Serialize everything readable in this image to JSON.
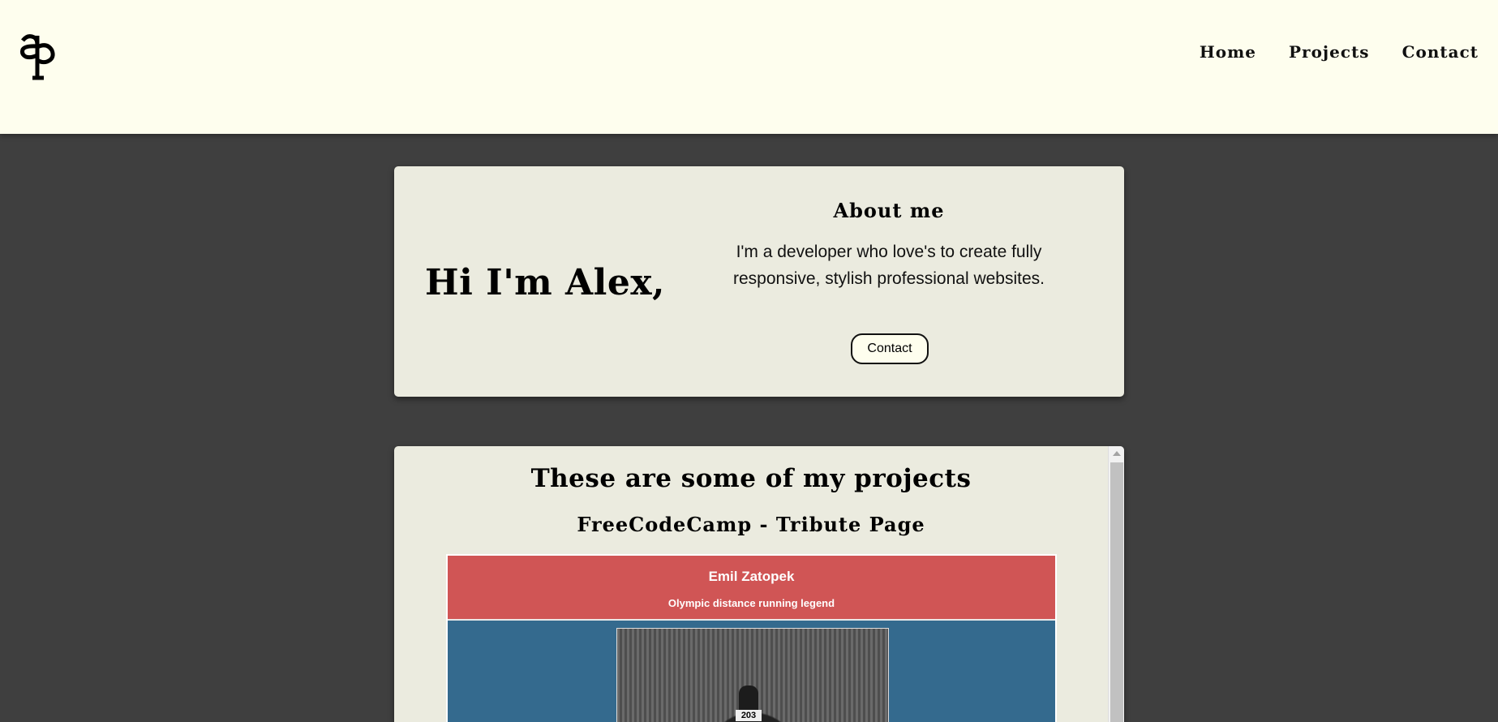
{
  "header": {
    "logo_icon": "ap-monogram-icon",
    "nav": [
      {
        "label": "Home"
      },
      {
        "label": "Projects"
      },
      {
        "label": "Contact"
      }
    ]
  },
  "about": {
    "greeting": "Hi I'm Alex,",
    "title": "About me",
    "text": "I'm a developer who love's to create fully responsive, stylish professional websites.",
    "contact_label": "Contact"
  },
  "projects": {
    "title": "These are some of my projects",
    "items": [
      {
        "name": "FreeCodeCamp - Tribute Page",
        "preview": {
          "title": "Emil Zatopek",
          "subtitle": "Olympic distance running legend",
          "bib": "203"
        }
      }
    ]
  },
  "colors": {
    "header_bg": "#fefeee",
    "page_bg": "#3f3f3f",
    "card_bg": "#ebebdf",
    "preview_red": "#d05555",
    "preview_blue": "#346a8e"
  }
}
